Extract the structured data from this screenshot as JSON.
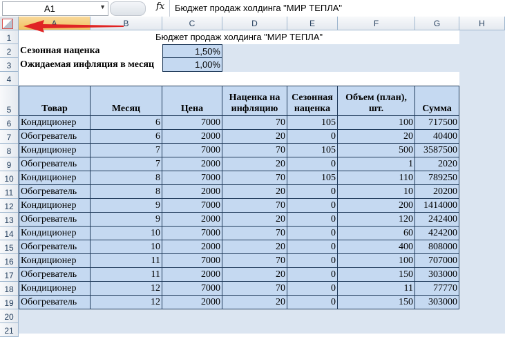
{
  "formula_bar": {
    "name_box": "A1",
    "name_box_dropdown": "▼",
    "fx_label": "fx",
    "formula": "Бюджет продаж холдинга \"МИР ТЕПЛА\""
  },
  "columns": [
    "A",
    "B",
    "C",
    "D",
    "E",
    "F",
    "G",
    "H"
  ],
  "selected_column": "A",
  "rows": [
    "1",
    "2",
    "3",
    "4",
    "5",
    "6",
    "7",
    "8",
    "9",
    "10",
    "11",
    "12",
    "13",
    "14",
    "15",
    "16",
    "17",
    "18",
    "19",
    "20",
    "21"
  ],
  "sheet": {
    "title": "Бюджет продаж холдинга \"МИР ТЕПЛА\"",
    "params": [
      {
        "label": "Сезонная наценка",
        "value": "1,50%"
      },
      {
        "label": "Ожидаемая инфляция в месяц",
        "value": "1,00%"
      }
    ],
    "headers": [
      "Товар",
      "Месяц",
      "Цена",
      "Наценка на инфляцию",
      "Сезонная наценка",
      "Объем (план), шт.",
      "Сумма"
    ],
    "table": [
      [
        "Кондиционер",
        "6",
        "7000",
        "70",
        "105",
        "100",
        "717500"
      ],
      [
        "Обогреватель",
        "6",
        "2000",
        "20",
        "0",
        "20",
        "40400"
      ],
      [
        "Кондиционер",
        "7",
        "7000",
        "70",
        "105",
        "500",
        "3587500"
      ],
      [
        "Обогреватель",
        "7",
        "2000",
        "20",
        "0",
        "1",
        "2020"
      ],
      [
        "Кондиционер",
        "8",
        "7000",
        "70",
        "105",
        "110",
        "789250"
      ],
      [
        "Обогреватель",
        "8",
        "2000",
        "20",
        "0",
        "10",
        "20200"
      ],
      [
        "Кондиционер",
        "9",
        "7000",
        "70",
        "0",
        "200",
        "1414000"
      ],
      [
        "Обогреватель",
        "9",
        "2000",
        "20",
        "0",
        "120",
        "242400"
      ],
      [
        "Кондиционер",
        "10",
        "7000",
        "70",
        "0",
        "60",
        "424200"
      ],
      [
        "Обогреватель",
        "10",
        "2000",
        "20",
        "0",
        "400",
        "808000"
      ],
      [
        "Кондиционер",
        "11",
        "7000",
        "70",
        "0",
        "100",
        "707000"
      ],
      [
        "Обогреватель",
        "11",
        "2000",
        "20",
        "0",
        "150",
        "303000"
      ],
      [
        "Кондиционер",
        "12",
        "7000",
        "70",
        "0",
        "11",
        "77770"
      ],
      [
        "Обогреватель",
        "12",
        "2000",
        "20",
        "0",
        "150",
        "303000"
      ]
    ]
  },
  "colors": {
    "cell_fill": "#c5d9f1",
    "sheet_bg": "#dbe5f1",
    "arrow": "#e02424"
  }
}
